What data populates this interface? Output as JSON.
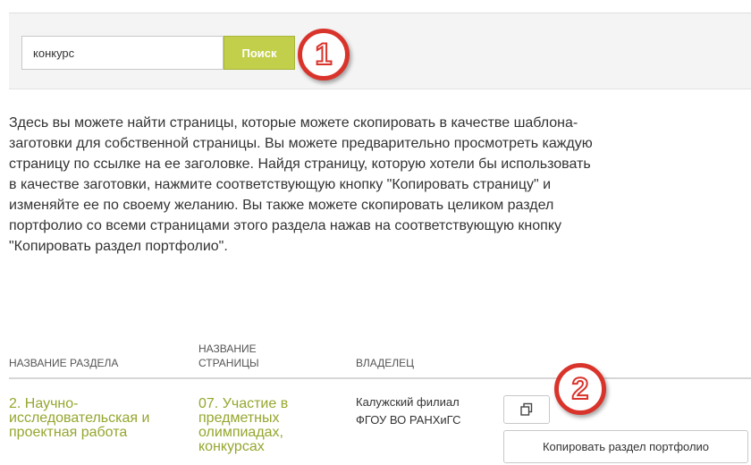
{
  "search": {
    "value": "конкурс",
    "button_label": "Поиск"
  },
  "callouts": {
    "first": "1",
    "second": "2"
  },
  "description": "Здесь вы можете найти страницы, которые можете скопировать в качестве шаблона-\nзаготовки для собственной страницы. Вы можете предварительно просмотреть каждую\nстраницу по ссылке на ее заголовке. Найдя страницу, которую хотели бы использовать\nв качестве заготовки, нажмите соответствующую кнопку \"Копировать страницу\" и\nизменяйте ее по своему желанию. Вы также можете скопировать целиком раздел\nпортфолио со всеми страницами этого раздела нажав на соответствующую кнопку\n\"Копировать раздел портфолио\".",
  "table": {
    "headers": {
      "section": "НАЗВАНИЕ РАЗДЕЛА",
      "page": "НАЗВАНИЕ СТРАНИЦЫ",
      "owner": "ВЛАДЕЛЕЦ"
    },
    "rows": [
      {
        "section": "2. Научно-исследовательская и проектная работа",
        "page": "07. Участие в предметных олимпиадах, конкурсах",
        "owner": "Калужский филиал ФГОУ ВО РАНХиГС",
        "copy_section_label": "Копировать раздел портфолио"
      }
    ]
  },
  "icons": {
    "copy_page": "copy-icon"
  },
  "colors": {
    "accent": "#c2cf4a",
    "link": "#96a62e",
    "callout": "#d9342b"
  }
}
